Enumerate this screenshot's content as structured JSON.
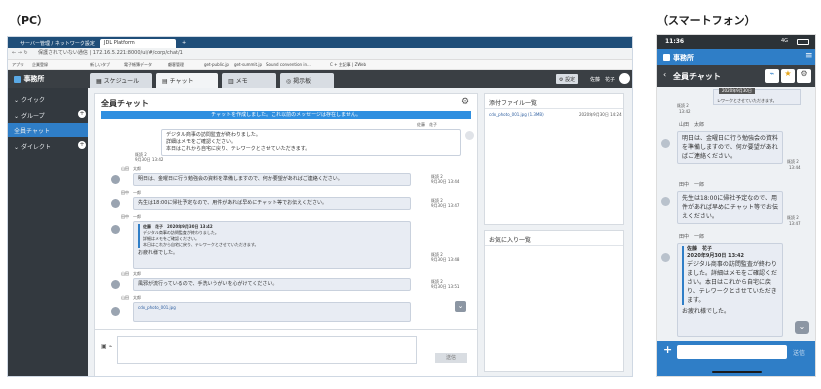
{
  "labels": {
    "pc": "（PC）",
    "phone": "（スマートフォン）"
  },
  "browser": {
    "tabs": [
      "サーバー管理 / ネットワーク設定",
      "JDL Platform"
    ],
    "new_tab": "+",
    "url": "保護されていない通信 | 172.16.5.221:8000/ui/#/corp/chat/1",
    "bookmarks": [
      "アプリ",
      "企業登録",
      "新しいタブ",
      "電子帳簿データ",
      "顧客管理",
      "get-public.jp",
      "get-summit.jp",
      "Sound convention in...",
      "C + 主記事 | ZWeb"
    ]
  },
  "app": {
    "logo": "事務所",
    "tabs": [
      "スケジュール",
      "チャット",
      "メモ",
      "掲示板"
    ],
    "settings": "設定",
    "user": "佐藤　花子"
  },
  "sidebar": {
    "items": [
      "クイック",
      "グループ",
      "全員チャット",
      "ダイレクト"
    ]
  },
  "chat": {
    "title": "全員チャット",
    "banner": "チャットを作成しました。これ以前のメッセージは存在しません。",
    "send": "送信",
    "msg1": {
      "sender": "佐藤　花子",
      "lines": [
        "デジタル商事の訪問監査が終わりました。",
        "詳細はメモをご確認ください。",
        "本日はこれから自宅に戻り、テレワークとさせていただきます。"
      ],
      "read": "既読 2",
      "time": "9月30日 13:42"
    },
    "msg2": {
      "sender": "山田　太郎",
      "text": "明日は、金曜日に行う勉強会の資料を準備しますので、何か要望があればご連絡ください。",
      "read": "既読 2",
      "time": "9月30日 13:44"
    },
    "msg3": {
      "sender": "田中　一郎",
      "text": "先生は18:00に帰社予定なので、用件があれば早めにチャット等でお伝えください。",
      "read": "既読 2",
      "time": "9月30日 13:47"
    },
    "msg4": {
      "sender": "田中　一郎",
      "quote_head": "佐藤　花子　2020年9月30日 13:42",
      "quote_lines": [
        "デジタル商事の訪問監査が終わりました。",
        "詳細はメモをご確認ください。",
        "本日はこれから自宅に戻り、テレワークとさせていただきます。"
      ],
      "reply": "お疲れ様でした。",
      "read": "既読 2",
      "time": "9月30日 13:48"
    },
    "msg5": {
      "sender": "山田　太郎",
      "text": "風邪が流行っているので、手洗いうがいを心がけてください。",
      "read": "既読 2",
      "time": "9月30日 13:51"
    },
    "msg6": {
      "sender": "山田　太郎",
      "file": "cdx_photo_001.jpg",
      "read": "既読 2",
      "time": "9月30日 14:24"
    }
  },
  "attachments": {
    "title": "添付ファイル一覧",
    "file": "cdx_photo_001.jpg (1.3MB)",
    "date": "2020年9月30日 14:24"
  },
  "favorites": {
    "title": "お気に入り一覧"
  },
  "phone": {
    "time": "11:36",
    "signal": "4G",
    "logo": "事務所",
    "title": "全員チャット",
    "tooltip": "2020年9月30日",
    "top_text": "レワークとさせていただきます。",
    "top_read": "既読 2",
    "top_time": "13:42",
    "m1": {
      "sender": "山田　太郎",
      "text": "明日は、金曜日に行う勉強会の資料を準備しますので、何か要望があればご連絡ください。",
      "read": "既読 2",
      "time": "13:44"
    },
    "m2": {
      "sender": "田中　一郎",
      "text": "先生は18:00に帰社予定なので、用件があれば早めにチャット等でお伝えください。",
      "read": "既読 2",
      "time": "13:47"
    },
    "m3": {
      "sender": "田中　一郎",
      "quote_name": "佐藤　花子",
      "quote_date": "2020年9月30日 13:42",
      "quote_text": "デジタル商事の訪問監査が終わりました。詳細はメモをご確認ください。本日はこれから自宅に戻り、テレワークとさせていただきます。",
      "reply": "お疲れ様でした。"
    },
    "send": "送信",
    "plus": "+"
  }
}
